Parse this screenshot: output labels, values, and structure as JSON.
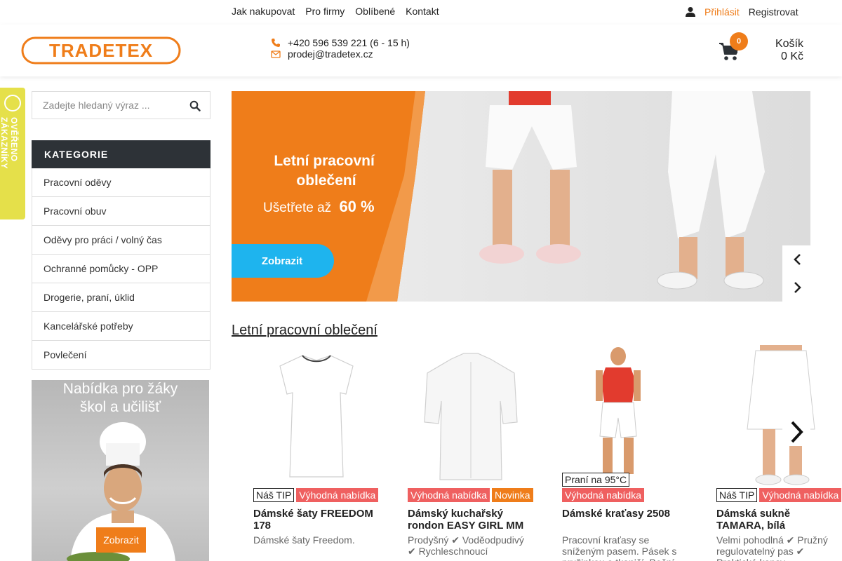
{
  "topnav": [
    "Jak nakupovat",
    "Pro firmy",
    "Oblíbené",
    "Kontakt"
  ],
  "user": {
    "login": "Přihlásit",
    "register": "Registrovat"
  },
  "logo": {
    "text": "TRADETEX"
  },
  "contact": {
    "phone": "+420 596 539 221 (6 - 15 h)",
    "email": "prodej@tradetex.cz"
  },
  "cart": {
    "count": "0",
    "label": "Košík",
    "total": "0 Kč"
  },
  "badge": {
    "text": "OVĚŘENO ZÁKAZNÍKY"
  },
  "search": {
    "placeholder": "Zadejte hledaný výraz ..."
  },
  "categories": {
    "title": "KATEGORIE",
    "items": [
      "Pracovní oděvy",
      "Pracovní obuv",
      "Oděvy pro práci / volný čas",
      "Ochranné pomůcky - OPP",
      "Drogerie, praní, úklid",
      "Kancelářské potřeby",
      "Povlečení"
    ]
  },
  "promo": {
    "title": "Nabídka pro žáky škol a učilišť",
    "button": "Zobrazit"
  },
  "banner": {
    "headline": "Letní pracovní oblečení",
    "subline_prefix": "Ušetřete až",
    "discount": "60 %",
    "button": "Zobrazit"
  },
  "section": {
    "title": "Letní pracovní oblečení"
  },
  "products": [
    {
      "tags": [
        "Náš TIP",
        "Výhodná nabídka"
      ],
      "name": "Dámské šaty FREEDOM 178",
      "desc": "Dámské šaty Freedom."
    },
    {
      "tags": [
        "Výhodná nabídka",
        "Novinka"
      ],
      "name": "Dámský kuchařský rondon EASY GIRL MM",
      "desc": "Prodyšný ✔ Voděodpudivý ✔ Rychleschnoucí"
    },
    {
      "wash": "Praní na 95°C",
      "tags": [
        "Výhodná nabídka"
      ],
      "name": "Dámské kraťasy 2508",
      "desc": "Pracovní kraťasy se sníženým pasem. Pásek s pružinkou a tkaničí. Boční"
    },
    {
      "tags": [
        "Náš TIP",
        "Výhodná nabídka"
      ],
      "name": "Dámská sukně TAMARA, bílá",
      "desc": "Velmi pohodlná ✔ Pružný regulovatelný pas ✔ Praktické kapsy"
    }
  ],
  "colors": {
    "accent": "#ef7d1a",
    "dark": "#2d3237",
    "offer": "#ef6060",
    "badge": "#e5e04a",
    "banner_cta": "#1eb4ee"
  }
}
